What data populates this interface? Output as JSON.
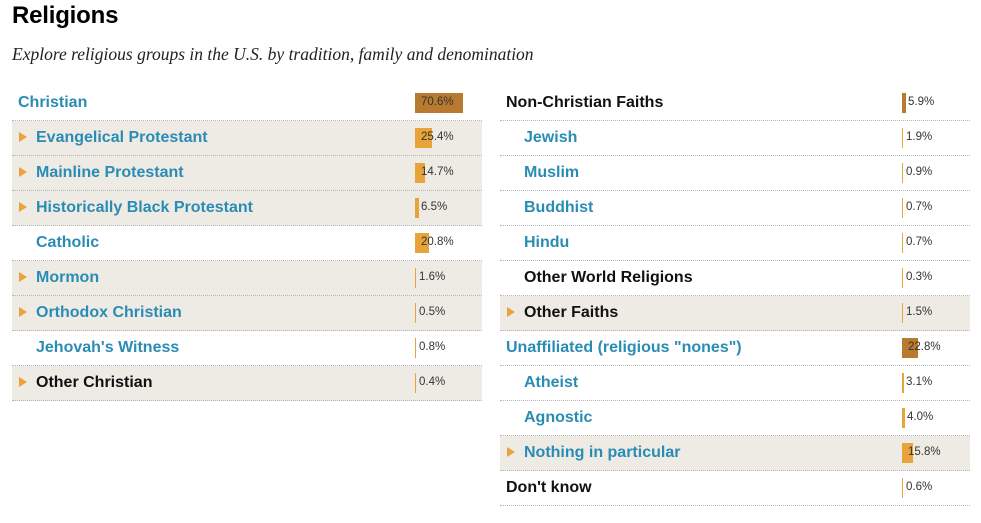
{
  "header": {
    "title": "Religions",
    "subtitle": "Explore religious groups in the U.S. by tradition, family and denomination"
  },
  "colors": {
    "link": "#2a8cb5",
    "dark_text": "#111111",
    "bar_top_level": "#b87a2e",
    "bar_child": "#e8a33a",
    "shaded_row": "#eeebe4",
    "arrow": "#e8a33a"
  },
  "left_column": [
    {
      "label": "Christian",
      "value": "70.6%",
      "pct": 70.6,
      "level": 0,
      "expandable": false,
      "style": "link",
      "shaded": false,
      "top": true
    },
    {
      "label": "Evangelical Protestant",
      "value": "25.4%",
      "pct": 25.4,
      "level": 1,
      "expandable": true,
      "style": "link",
      "shaded": true
    },
    {
      "label": "Mainline Protestant",
      "value": "14.7%",
      "pct": 14.7,
      "level": 1,
      "expandable": true,
      "style": "link",
      "shaded": true
    },
    {
      "label": "Historically Black Protestant",
      "value": "6.5%",
      "pct": 6.5,
      "level": 1,
      "expandable": true,
      "style": "link",
      "shaded": true
    },
    {
      "label": "Catholic",
      "value": "20.8%",
      "pct": 20.8,
      "level": 1,
      "expandable": false,
      "style": "link",
      "shaded": false
    },
    {
      "label": "Mormon",
      "value": "1.6%",
      "pct": 1.6,
      "level": 1,
      "expandable": true,
      "style": "link",
      "shaded": true
    },
    {
      "label": "Orthodox Christian",
      "value": "0.5%",
      "pct": 0.5,
      "level": 1,
      "expandable": true,
      "style": "link",
      "shaded": true
    },
    {
      "label": "Jehovah's Witness",
      "value": "0.8%",
      "pct": 0.8,
      "level": 1,
      "expandable": false,
      "style": "link",
      "shaded": false
    },
    {
      "label": "Other Christian",
      "value": "0.4%",
      "pct": 0.4,
      "level": 1,
      "expandable": true,
      "style": "dark",
      "shaded": true
    }
  ],
  "right_column": [
    {
      "label": "Non-Christian Faiths",
      "value": "5.9%",
      "pct": 5.9,
      "level": 0,
      "expandable": false,
      "style": "dark",
      "shaded": false,
      "top": true
    },
    {
      "label": "Jewish",
      "value": "1.9%",
      "pct": 1.9,
      "level": 1,
      "expandable": false,
      "style": "link",
      "shaded": false
    },
    {
      "label": "Muslim",
      "value": "0.9%",
      "pct": 0.9,
      "level": 1,
      "expandable": false,
      "style": "link",
      "shaded": false
    },
    {
      "label": "Buddhist",
      "value": "0.7%",
      "pct": 0.7,
      "level": 1,
      "expandable": false,
      "style": "link",
      "shaded": false
    },
    {
      "label": "Hindu",
      "value": "0.7%",
      "pct": 0.7,
      "level": 1,
      "expandable": false,
      "style": "link",
      "shaded": false
    },
    {
      "label": "Other World Religions",
      "value": "0.3%",
      "pct": 0.3,
      "level": 1,
      "expandable": false,
      "style": "dark",
      "shaded": false
    },
    {
      "label": "Other Faiths",
      "value": "1.5%",
      "pct": 1.5,
      "level": 1,
      "expandable": true,
      "style": "dark",
      "shaded": true
    },
    {
      "label": "Unaffiliated (religious \"nones\")",
      "value": "22.8%",
      "pct": 22.8,
      "level": 0,
      "expandable": false,
      "style": "link",
      "shaded": false,
      "top": true
    },
    {
      "label": "Atheist",
      "value": "3.1%",
      "pct": 3.1,
      "level": 1,
      "expandable": false,
      "style": "link",
      "shaded": false
    },
    {
      "label": "Agnostic",
      "value": "4.0%",
      "pct": 4.0,
      "level": 1,
      "expandable": false,
      "style": "link",
      "shaded": false
    },
    {
      "label": "Nothing in particular",
      "value": "15.8%",
      "pct": 15.8,
      "level": 1,
      "expandable": true,
      "style": "link",
      "shaded": true
    },
    {
      "label": "Don't know",
      "value": "0.6%",
      "pct": 0.6,
      "level": 0,
      "expandable": false,
      "style": "dark",
      "shaded": false
    }
  ]
}
